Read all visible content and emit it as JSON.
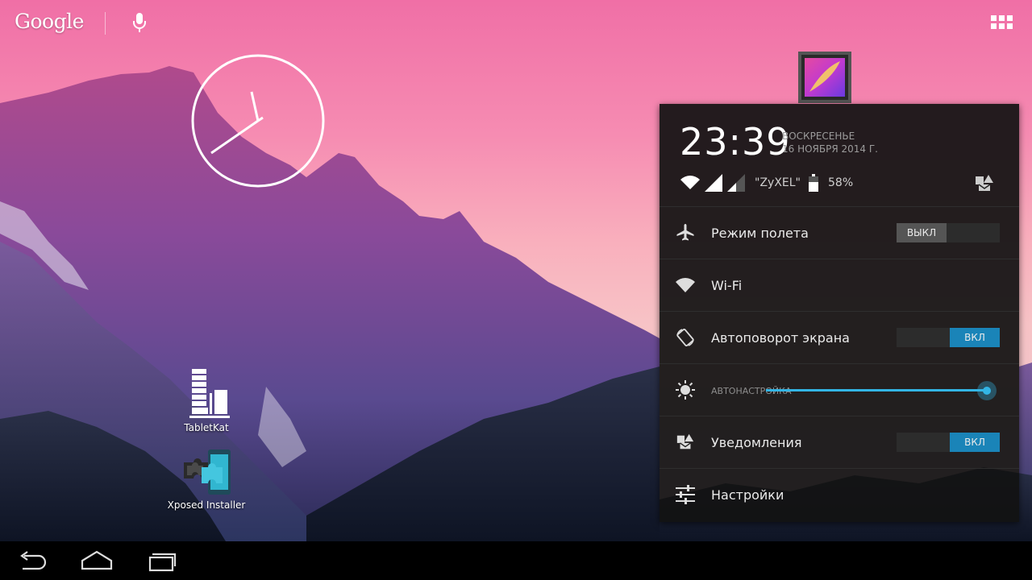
{
  "search_bar": {
    "logo_text": "Google",
    "icons": [
      "mic-icon",
      "apps-grid-icon"
    ]
  },
  "desktop": {
    "widgets": [
      "analog-clock-widget"
    ],
    "icons": [
      {
        "label": "TabletKat",
        "icon": "tabletkat-icon"
      },
      {
        "label": "Xposed Installer",
        "icon": "puzzle-phone-icon"
      }
    ],
    "floating_icon": "gallery-icon"
  },
  "quick_settings": {
    "time": "23:39",
    "day": "ВОСКРЕСЕНЬЕ",
    "date": "16 НОЯБРЯ 2014 Г.",
    "network_name": "\"ZyXEL\"",
    "battery": "58%",
    "rows": [
      {
        "label": "Режим полета",
        "icon": "airplane-icon",
        "toggle": "ВЫКЛ"
      },
      {
        "label": "Wi-Fi",
        "icon": "wifi-icon"
      },
      {
        "label": "Автоповорот экрана",
        "icon": "rotate-icon",
        "toggle": "ВКЛ"
      },
      {
        "label": "АВТОНАСТРОЙКА",
        "icon": "brightness-icon",
        "brightness_level": 0.97
      },
      {
        "label": "Уведомления",
        "icon": "notifications-icon",
        "toggle": "ВКЛ"
      },
      {
        "label": "Настройки",
        "icon": "settings-sliders-icon"
      }
    ],
    "accent_color": "#33b5e5",
    "toggle_on_color": "#1a84b8"
  },
  "navigation": {
    "buttons": [
      "back-icon",
      "home-icon",
      "recent-apps-icon"
    ]
  }
}
